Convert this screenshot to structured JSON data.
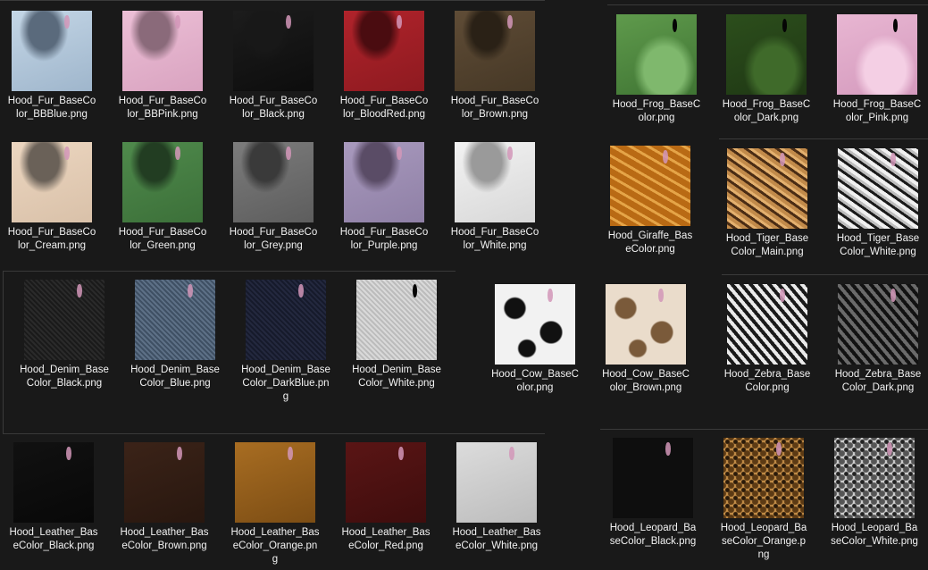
{
  "grid": {
    "items": [
      {
        "label": "Hood_Fur_BaseColor_BBBlue.png"
      },
      {
        "label": "Hood_Fur_BaseColor_BBPink.png"
      },
      {
        "label": "Hood_Fur_BaseColor_Black.png"
      },
      {
        "label": "Hood_Fur_BaseColor_BloodRed.png"
      },
      {
        "label": "Hood_Fur_BaseColor_Brown.png"
      },
      {
        "label": "Hood_Fur_BaseColor_Cream.png"
      },
      {
        "label": "Hood_Fur_BaseColor_Green.png"
      },
      {
        "label": "Hood_Fur_BaseColor_Grey.png"
      },
      {
        "label": "Hood_Fur_BaseColor_Purple.png"
      },
      {
        "label": "Hood_Fur_BaseColor_White.png"
      },
      {
        "label": "Hood_Denim_BaseColor_Black.png"
      },
      {
        "label": "Hood_Denim_BaseColor_Blue.png"
      },
      {
        "label": "Hood_Denim_BaseColor_DarkBlue.png"
      },
      {
        "label": "Hood_Denim_BaseColor_White.png"
      },
      {
        "label": "Hood_Leather_BaseColor_Black.png"
      },
      {
        "label": "Hood_Leather_BaseColor_Brown.png"
      },
      {
        "label": "Hood_Leather_BaseColor_Orange.png"
      },
      {
        "label": "Hood_Leather_BaseColor_Red.png"
      },
      {
        "label": "Hood_Leather_BaseColor_White.png"
      },
      {
        "label": "Hood_Frog_BaseColor.png"
      },
      {
        "label": "Hood_Frog_BaseColor_Dark.png"
      },
      {
        "label": "Hood_Frog_BaseColor_Pink.png"
      },
      {
        "label": "Hood_Giraffe_BaseColor.png"
      },
      {
        "label": "Hood_Tiger_BaseColor_Main.png"
      },
      {
        "label": "Hood_Tiger_BaseColor_White.png"
      },
      {
        "label": "Hood_Cow_BaseColor.png"
      },
      {
        "label": "Hood_Cow_BaseColor_Brown.png"
      },
      {
        "label": "Hood_Zebra_BaseColor.png"
      },
      {
        "label": "Hood_Zebra_BaseColor_Dark.png"
      },
      {
        "label": "Hood_Leopard_BaseColor_Black.png"
      },
      {
        "label": "Hood_Leopard_BaseColor_Orange.png"
      },
      {
        "label": "Hood_Leopard_BaseColor_White.png"
      }
    ]
  }
}
